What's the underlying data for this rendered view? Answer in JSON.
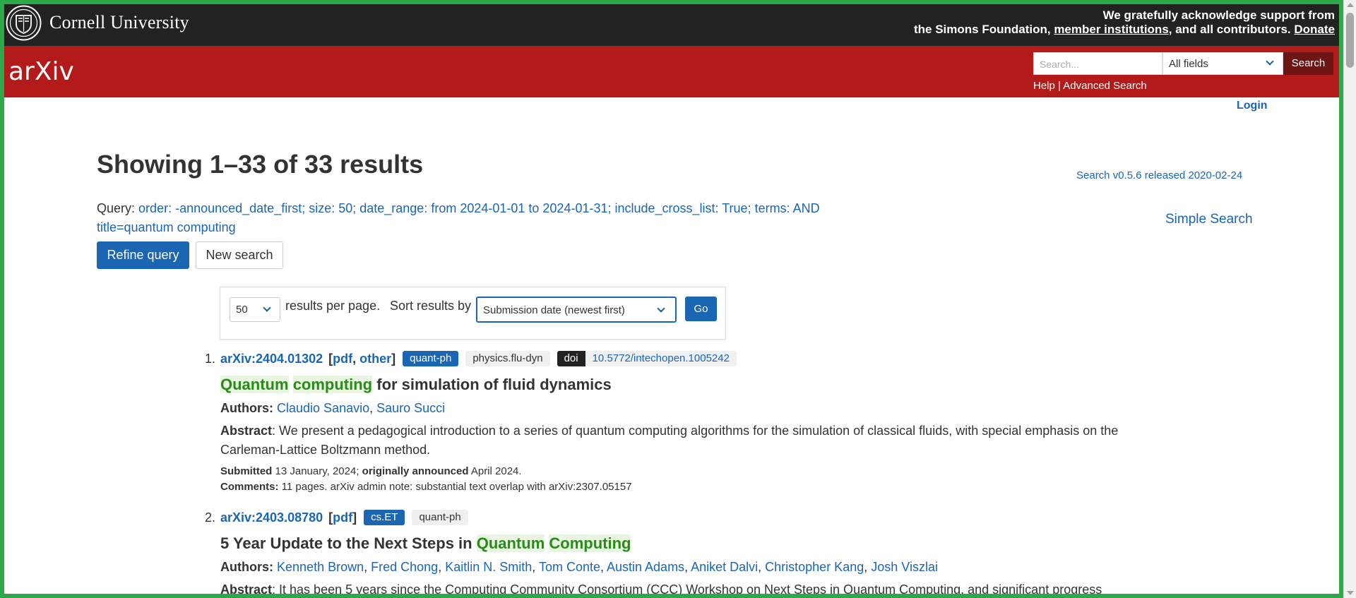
{
  "colors": {
    "cornell_bar": "#222222",
    "arxiv_red": "#b31b1b",
    "link_blue": "#1a66b3",
    "highlight_green": "#2a8b1a"
  },
  "header": {
    "institution": "Cornell University",
    "support_line1": "We gratefully acknowledge support from",
    "support_line2_prefix": "the Simons Foundation,",
    "member_institutions": "member institutions",
    "support_line2_suffix": ", and all contributors.",
    "donate": "Donate"
  },
  "arxiv_bar": {
    "logo_text": "arXiv",
    "search_placeholder": "Search...",
    "field_selected": "All fields",
    "search_button": "Search",
    "help": "Help",
    "separator": "|",
    "advanced_search": "Advanced Search"
  },
  "login": "Login",
  "page": {
    "title": "Showing 1–33 of 33 results",
    "version": "Search v0.5.6 released 2020-02-24",
    "simple_search": "Simple Search",
    "query_label": "Query:",
    "query_line1": "order: -announced_date_first; size: 50; date_range: from 2024-01-01 to 2024-01-31; include_cross_list: True; terms: AND",
    "query_line2": "title=quantum computing",
    "refine_button": "Refine query",
    "new_button": "New search"
  },
  "controls": {
    "per_page_value": "50",
    "per_page_label": "results per page.",
    "sort_label": "Sort results by",
    "sort_value": "Submission date (newest first)",
    "go_button": "Go"
  },
  "results": [
    {
      "num": "1.",
      "id": "arXiv:2404.01302",
      "links": [
        "pdf",
        "other"
      ],
      "primary_tag": "quant-ph",
      "secondary_tags": [
        "physics.flu-dyn"
      ],
      "doi_label": "doi",
      "doi": "10.5772/intechopen.1005242",
      "title_hl1": "Quantum",
      "title_hl2": "computing",
      "title_rest": " for simulation of fluid dynamics",
      "authors_label": "Authors:",
      "authors": [
        "Claudio Sanavio",
        "Sauro Succi"
      ],
      "abstract_label": "Abstract",
      "abstract": ": We present a pedagogical introduction to a series of quantum computing algorithms for the simulation of classical fluids, with special emphasis on the Carleman-Lattice Boltzmann method.",
      "submitted_label": "Submitted",
      "submitted": " 13 January, 2024; ",
      "announced_label": "originally announced",
      "announced": " April 2024.",
      "comments_label": "Comments:",
      "comments": " 11 pages. arXiv admin note: substantial text overlap with arXiv:2307.05157"
    },
    {
      "num": "2.",
      "id": "arXiv:2403.08780",
      "links": [
        "pdf"
      ],
      "primary_tag": "cs.ET",
      "secondary_tags": [
        "quant-ph"
      ],
      "title_prefix": "5 Year Update to the Next Steps in ",
      "title_hl1": "Quantum",
      "title_hl2": "Computing",
      "authors_label": "Authors:",
      "authors": [
        "Kenneth Brown",
        "Fred Chong",
        "Kaitlin N. Smith",
        "Tom Conte",
        "Austin Adams",
        "Aniket Dalvi",
        "Christopher Kang",
        "Josh Viszlai"
      ],
      "abstract_label": "Abstract",
      "abstract": ": It has been 5 years since the Computing Community Consortium (CCC) Workshop on Next Steps in Quantum Computing, and significant progress"
    }
  ]
}
